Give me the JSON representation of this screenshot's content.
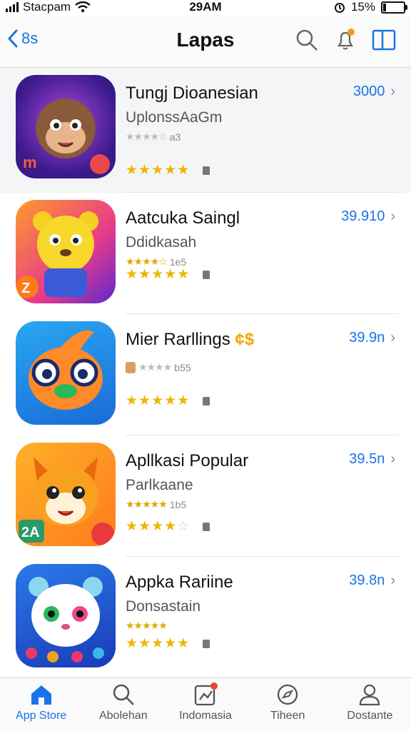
{
  "status": {
    "carrier": "Stacpam",
    "time": "29AM",
    "battery": "15%"
  },
  "nav": {
    "back_label": "8s",
    "title": "Lapas"
  },
  "apps": [
    {
      "name": "Tungj Dioanesian",
      "subtitle": "UplonssAaGm",
      "mini_rating_text": "a3",
      "price": "3000",
      "stars_shown": 5
    },
    {
      "name": "Aatcuka Saingl",
      "subtitle": "Ddidkasah",
      "mini_rating_text": "1e5",
      "price": "39.910",
      "stars_shown": 5
    },
    {
      "name": "Mier Rarllings",
      "subtitle": "",
      "mini_rating_text": "b55",
      "price": "39.9n",
      "stars_shown": 5
    },
    {
      "name": "Apllkasi Popular",
      "subtitle": "Parlkaane",
      "mini_rating_text": "1b5",
      "price": "39.5n",
      "stars_shown": 4
    },
    {
      "name": "Appka Rariine",
      "subtitle": "Donsastain",
      "mini_rating_text": "",
      "price": "39.8n",
      "stars_shown": 5
    }
  ],
  "tabs": [
    {
      "label": "App Store",
      "icon": "home-icon",
      "active": true
    },
    {
      "label": "Abolehan",
      "icon": "search-icon",
      "active": false
    },
    {
      "label": "Indomasia",
      "icon": "chart-icon",
      "active": false
    },
    {
      "label": "Tiheen",
      "icon": "compass-icon",
      "active": false
    },
    {
      "label": "Dostante",
      "icon": "person-icon",
      "active": false
    }
  ],
  "colors": {
    "accent": "#1a73e8",
    "star": "#f0b400"
  }
}
